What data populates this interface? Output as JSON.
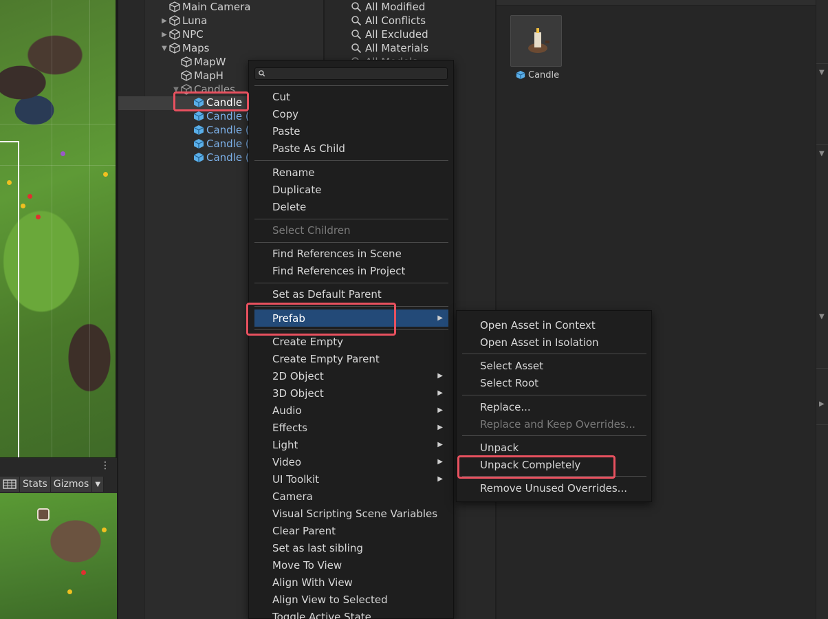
{
  "hierarchy": {
    "items": [
      {
        "label": "Main Camera",
        "type": "gameobject"
      },
      {
        "label": "Luna",
        "type": "gameobject"
      },
      {
        "label": "NPC",
        "type": "gameobject"
      },
      {
        "label": "Maps",
        "type": "gameobject"
      },
      {
        "label": "MapW",
        "type": "gameobject"
      },
      {
        "label": "MapH",
        "type": "gameobject"
      },
      {
        "label": "Candles",
        "type": "gameobject"
      },
      {
        "label": "Candle",
        "type": "prefab",
        "selected": true
      },
      {
        "label": "Candle (",
        "type": "prefab"
      },
      {
        "label": "Candle (",
        "type": "prefab"
      },
      {
        "label": "Candle (",
        "type": "prefab"
      },
      {
        "label": "Candle (",
        "type": "prefab"
      }
    ]
  },
  "search_filters": {
    "items": [
      "All Modified",
      "All Conflicts",
      "All Excluded",
      "All Materials",
      "All Models"
    ]
  },
  "project_asset": {
    "label": "Candle",
    "icon": "prefab-cube-icon"
  },
  "game_toolbar": {
    "stats_label": "Stats",
    "gizmos_label": "Gizmos",
    "kebab": "⋮"
  },
  "context_menu": {
    "search_placeholder": "",
    "items": [
      {
        "label": "Cut"
      },
      {
        "label": "Copy"
      },
      {
        "label": "Paste"
      },
      {
        "label": "Paste As Child"
      },
      {
        "label": "Rename"
      },
      {
        "label": "Duplicate"
      },
      {
        "label": "Delete"
      },
      {
        "label": "Select Children",
        "disabled": true
      },
      {
        "label": "Find References in Scene"
      },
      {
        "label": "Find References in Project"
      },
      {
        "label": "Set as Default Parent"
      },
      {
        "label": "Prefab",
        "submenu": true,
        "highlighted": true
      },
      {
        "label": "Create Empty"
      },
      {
        "label": "Create Empty Parent"
      },
      {
        "label": "2D Object",
        "submenu": true
      },
      {
        "label": "3D Object",
        "submenu": true
      },
      {
        "label": "Audio",
        "submenu": true
      },
      {
        "label": "Effects",
        "submenu": true
      },
      {
        "label": "Light",
        "submenu": true
      },
      {
        "label": "Video",
        "submenu": true
      },
      {
        "label": "UI Toolkit",
        "submenu": true
      },
      {
        "label": "Camera"
      },
      {
        "label": "Visual Scripting Scene Variables"
      },
      {
        "label": "Clear Parent"
      },
      {
        "label": "Set as last sibling"
      },
      {
        "label": "Move To View"
      },
      {
        "label": "Align With View"
      },
      {
        "label": "Align View to Selected"
      },
      {
        "label": "Toggle Active State"
      }
    ]
  },
  "prefab_submenu": {
    "items": [
      {
        "label": "Open Asset in Context"
      },
      {
        "label": "Open Asset in Isolation"
      },
      {
        "label": "Select Asset"
      },
      {
        "label": "Select Root"
      },
      {
        "label": "Replace..."
      },
      {
        "label": "Replace and Keep Overrides...",
        "disabled": true
      },
      {
        "label": "Unpack"
      },
      {
        "label": "Unpack Completely",
        "highlighted_box": true
      },
      {
        "label": "Remove Unused Overrides..."
      }
    ]
  },
  "colors": {
    "menu_bg": "#1e1e1e",
    "highlight": "#234a78",
    "prefab_text": "#7cb0e8",
    "annotation_red": "#e8515f"
  }
}
